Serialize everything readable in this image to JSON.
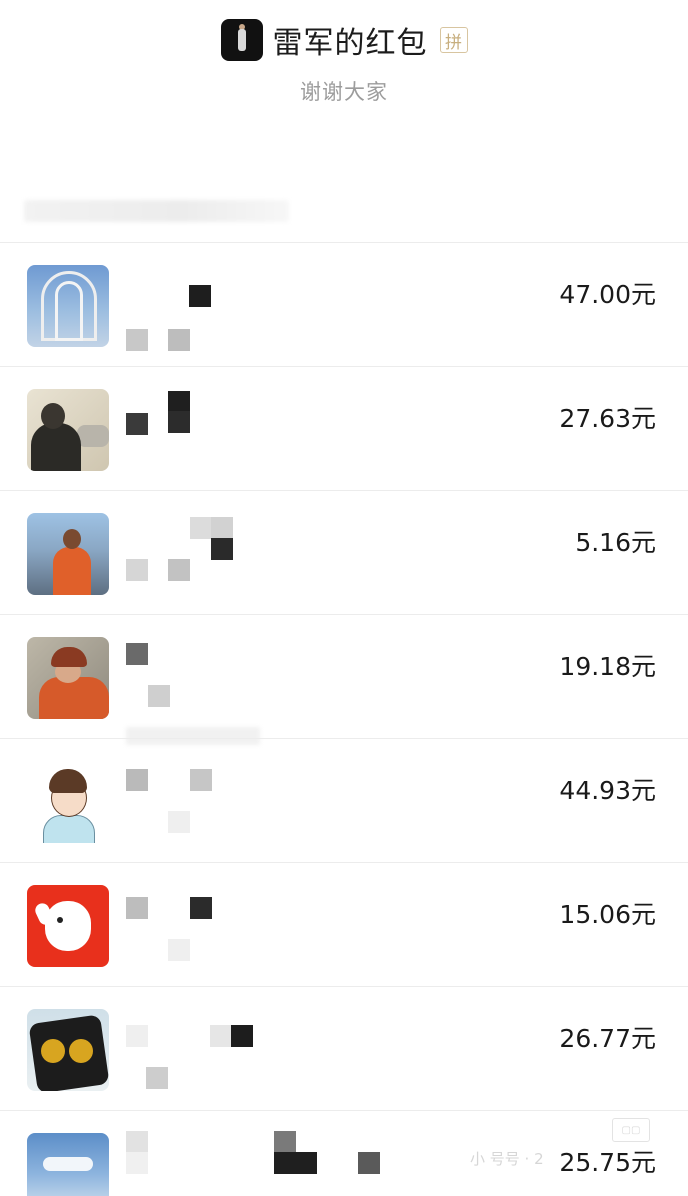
{
  "header": {
    "title": "雷军的红包",
    "badge": "拼",
    "subtitle": "谢谢大家"
  },
  "watermark": {
    "text": "小 号号 · 2"
  },
  "list": [
    {
      "amount": "47.00元",
      "avatar": "user-avatar-tower"
    },
    {
      "amount": "27.63元",
      "avatar": "user-avatar-cameraman"
    },
    {
      "amount": "5.16元",
      "avatar": "user-avatar-mountain"
    },
    {
      "amount": "19.18元",
      "avatar": "user-avatar-cap"
    },
    {
      "amount": "44.93元",
      "avatar": "user-avatar-cartoon"
    },
    {
      "amount": "15.06元",
      "avatar": "user-avatar-jd-dog"
    },
    {
      "amount": "26.77元",
      "avatar": "user-avatar-coins"
    },
    {
      "amount": "25.75元",
      "avatar": "user-avatar-sky"
    }
  ]
}
